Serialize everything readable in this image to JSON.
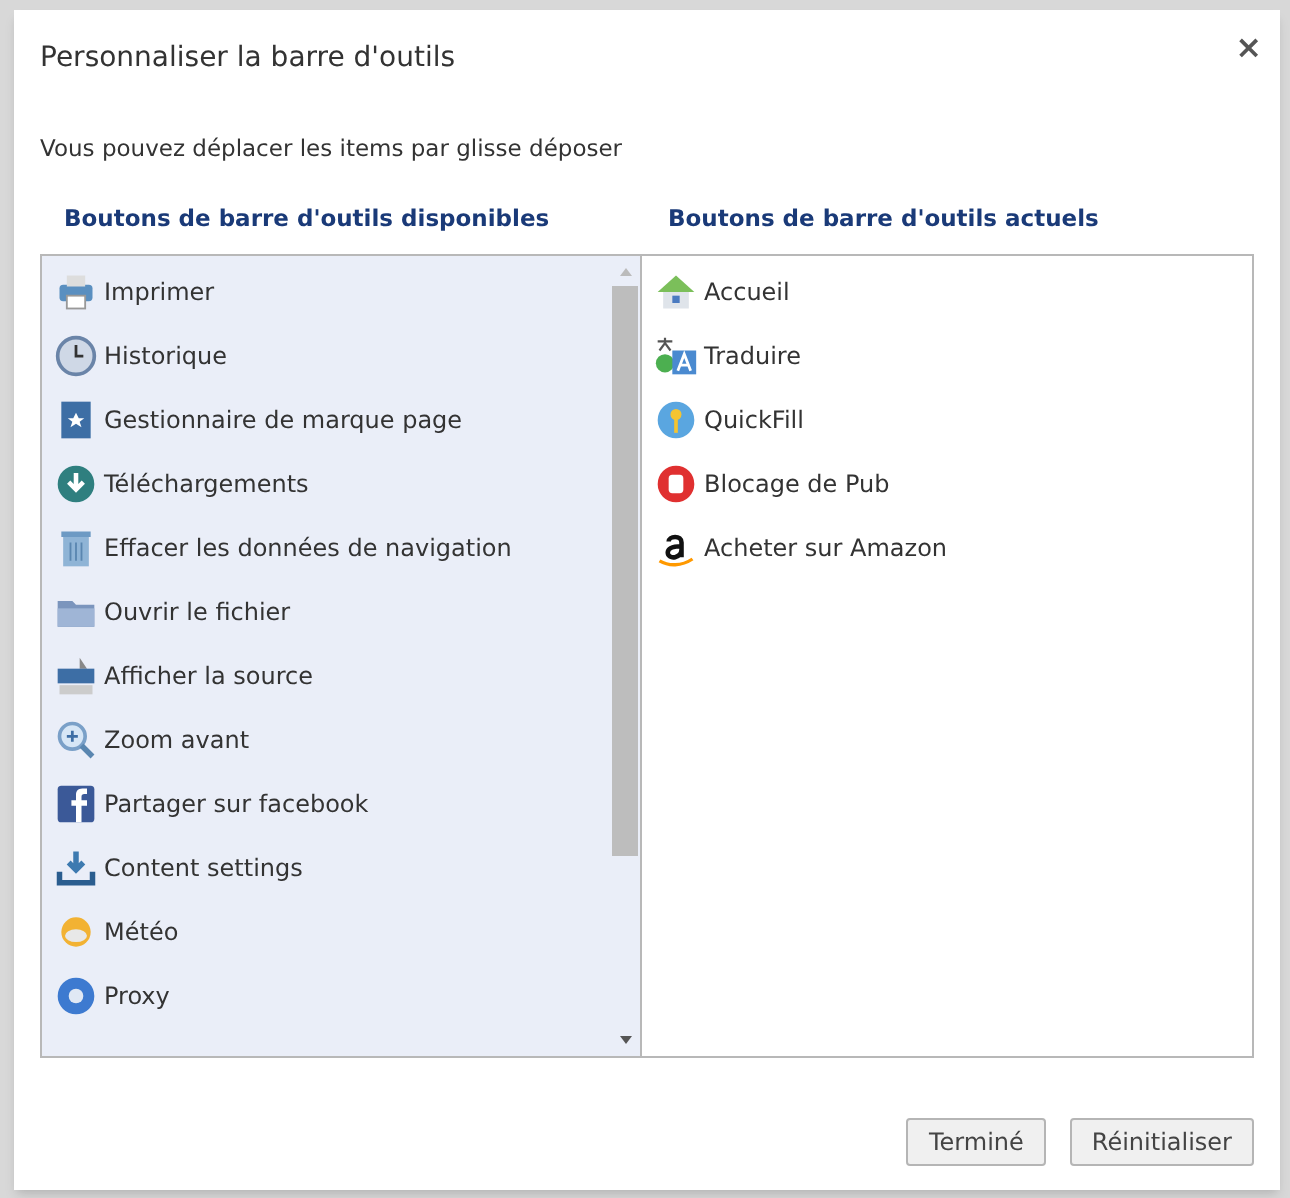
{
  "dialog": {
    "title": "Personnaliser la barre d'outils",
    "close": "×",
    "instruction": "Vous pouvez déplacer les items par glisse déposer"
  },
  "available": {
    "heading": "Boutons de barre d'outils disponibles",
    "items": [
      {
        "label": "Imprimer"
      },
      {
        "label": "Historique"
      },
      {
        "label": "Gestionnaire de marque page"
      },
      {
        "label": "Téléchargements"
      },
      {
        "label": "Effacer les données de navigation"
      },
      {
        "label": "Ouvrir le fichier"
      },
      {
        "label": "Afficher la source"
      },
      {
        "label": "Zoom avant"
      },
      {
        "label": "Partager sur facebook"
      },
      {
        "label": "Content settings"
      },
      {
        "label": "Météo"
      },
      {
        "label": "Proxy"
      }
    ]
  },
  "current": {
    "heading": "Boutons de barre d'outils actuels",
    "items": [
      {
        "label": "Accueil"
      },
      {
        "label": "Traduire"
      },
      {
        "label": "QuickFill"
      },
      {
        "label": "Blocage de Pub"
      },
      {
        "label": "Acheter sur Amazon"
      }
    ]
  },
  "buttons": [
    {
      "label": "Terminé"
    },
    {
      "label": "Réinitialiser"
    }
  ]
}
